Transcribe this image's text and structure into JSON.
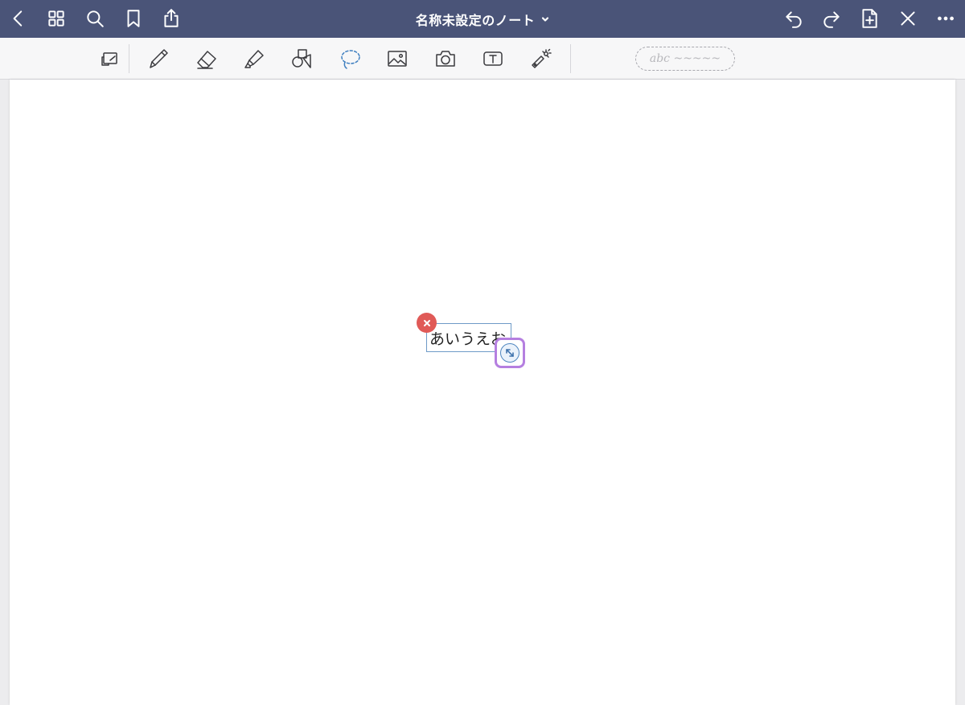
{
  "header": {
    "title": "名称未設定のノート",
    "icons": [
      "back-icon",
      "thumbnail-grid-icon",
      "search-icon",
      "bookmark-icon",
      "share-icon",
      "undo-icon",
      "redo-icon",
      "add-page-icon",
      "close-pen-icon",
      "more-icon"
    ]
  },
  "toolbar": {
    "tools": [
      "page-zoom-icon",
      "pen-icon",
      "eraser-icon",
      "highlighter-icon",
      "shapes-icon",
      "lasso-icon",
      "image-icon",
      "camera-icon",
      "text-box-icon",
      "laser-pointer-icon"
    ],
    "handwriting_placeholder": "abc ~~~~~",
    "lasso_bluetooth": "bluetooth-icon"
  },
  "canvas": {
    "text_content": "あいうえお",
    "selection_border_color": "#6e9ac7",
    "delete_color": "#e05a57",
    "resize_highlight_color": "#b57fe0"
  },
  "colors": {
    "header_bg": "#4a5478",
    "toolbar_bg": "#f7f7f8",
    "page_bg": "#ffffff"
  }
}
